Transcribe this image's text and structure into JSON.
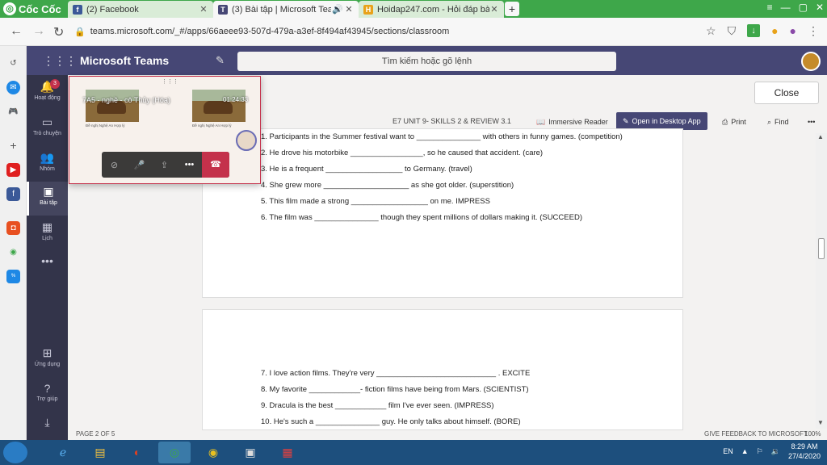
{
  "browser": {
    "brand": "Cốc Cốc",
    "tabs": [
      {
        "title": "(2) Facebook"
      },
      {
        "title": "(3) Bài tập | Microsoft Tea"
      },
      {
        "title": "Hoidap247.com - Hỏi đáp bài"
      }
    ],
    "url": "teams.microsoft.com/_#/apps/66aeee93-507d-479a-a3ef-8f494af43945/sections/classroom"
  },
  "teams": {
    "title": "Microsoft Teams",
    "search_placeholder": "Tìm kiếm hoặc gõ lệnh",
    "rail": [
      {
        "label": "Hoạt động",
        "badge": "3"
      },
      {
        "label": "Trò chuyện"
      },
      {
        "label": "Nhóm"
      },
      {
        "label": "Bài tập"
      },
      {
        "label": "Lịch"
      },
      {
        "label": "Ứng dụng"
      },
      {
        "label": "Trợ giúp"
      }
    ]
  },
  "call": {
    "name": "7A5 - nghề - cô Thủy (Hóa)",
    "time": "01:24:33",
    "caption_left": "Đề nghị Nghệ An Hợp lý",
    "caption_right": "Đề nghị Nghệ An Hợp lý"
  },
  "document": {
    "close_label": "Close",
    "title": "E7 UNIT 9- SKILLS 2 & REVIEW 3.1",
    "toolbar": {
      "immersive": "Immersive Reader",
      "open_desktop": "Open in Desktop App",
      "print": "Print",
      "find": "Find"
    },
    "page1_lines": [
      "1. Participants in the Summer festival want to _______________ with others in funny games. (competition)",
      "2. He drove his motorbike _________________, so he caused that accident. (care)",
      "3. He is a frequent __________________ to Germany. (travel)",
      "4. She grew more ____________________ as she got older. (superstition)",
      "5. This film made a strong __________________ on me. IMPRESS",
      "6. The film was _______________ though they spent  millions of dollars making it. (SUCCEED)"
    ],
    "page2_lines": [
      "7. I love action films. They're very  ____________________________ . EXCITE",
      "8. My favorite ____________- fiction films have being from Mars. (SCIENTIST)",
      "9. Dracula  is the best ____________ film I've ever seen. (IMPRESS)",
      "10.  He's such a _______________ guy. He only talks about himself. (BORE)"
    ],
    "page_indicator": "PAGE 2 OF 5",
    "feedback": "GIVE FEEDBACK TO MICROSOFT",
    "zoom": "100%"
  },
  "taskbar": {
    "lang": "EN",
    "time": "8:29 AM",
    "date": "27/4/2020"
  }
}
